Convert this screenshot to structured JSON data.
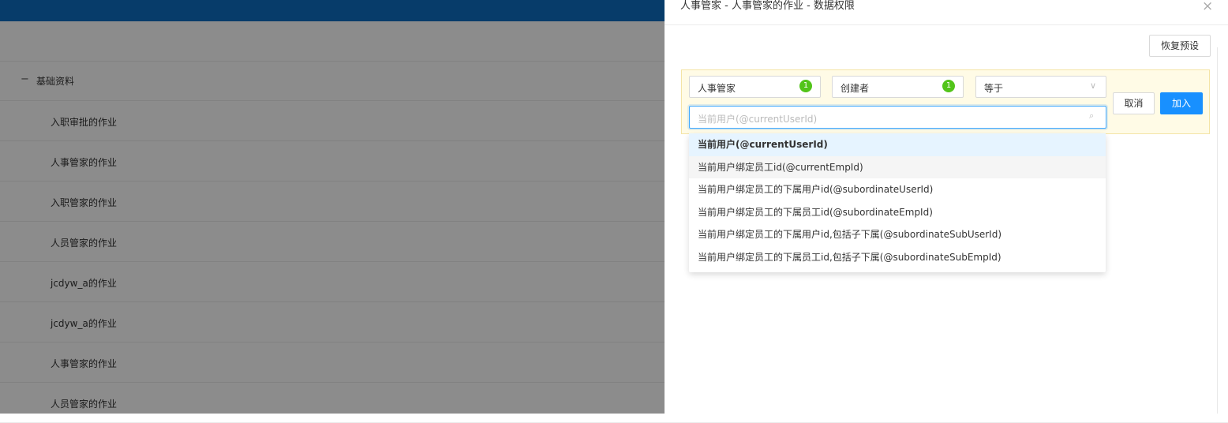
{
  "background": {
    "tree": {
      "group": {
        "label": "基础资料",
        "toggle": "−"
      },
      "items": [
        "入职审批的作业",
        "人事管家的作业",
        "入职管家的作业",
        "人员管家的作业",
        "jcdyw_a的作业",
        "jcdyw_a的作业",
        "人事管家的作业",
        "人员管家的作业"
      ]
    }
  },
  "drawer": {
    "title": "人事管家 - 人事管家的作业 - 数据权限",
    "close": "×",
    "restore_label": "恢复预设",
    "filter": {
      "table_field": {
        "label": "人事管家",
        "badge": "1"
      },
      "column_field": {
        "label": "创建者",
        "badge": "1"
      },
      "operator": {
        "label": "等于",
        "chevron": "∨"
      },
      "value_placeholder": "当前用户(@currentUserId)",
      "search_icon": "⌕",
      "cancel_label": "取消",
      "add_label": "加入"
    },
    "dropdown": {
      "options": [
        "当前用户(@currentUserId)",
        "当前用户绑定员工id(@currentEmpId)",
        "当前用户绑定员工的下属用户id(@subordinateUserId)",
        "当前用户绑定员工的下属员工id(@subordinateEmpId)",
        "当前用户绑定员工的下属用户id,包括子下属(@subordinateSubUserId)",
        "当前用户绑定员工的下属员工id,包括子下属(@subordinateSubEmpId)"
      ],
      "selected_index": 0,
      "hovered_index": 1
    }
  },
  "colors": {
    "header_blue": "#0d6ec2",
    "primary": "#1890ff",
    "badge_green": "#52c41a",
    "filter_bg": "#fffbe6"
  }
}
